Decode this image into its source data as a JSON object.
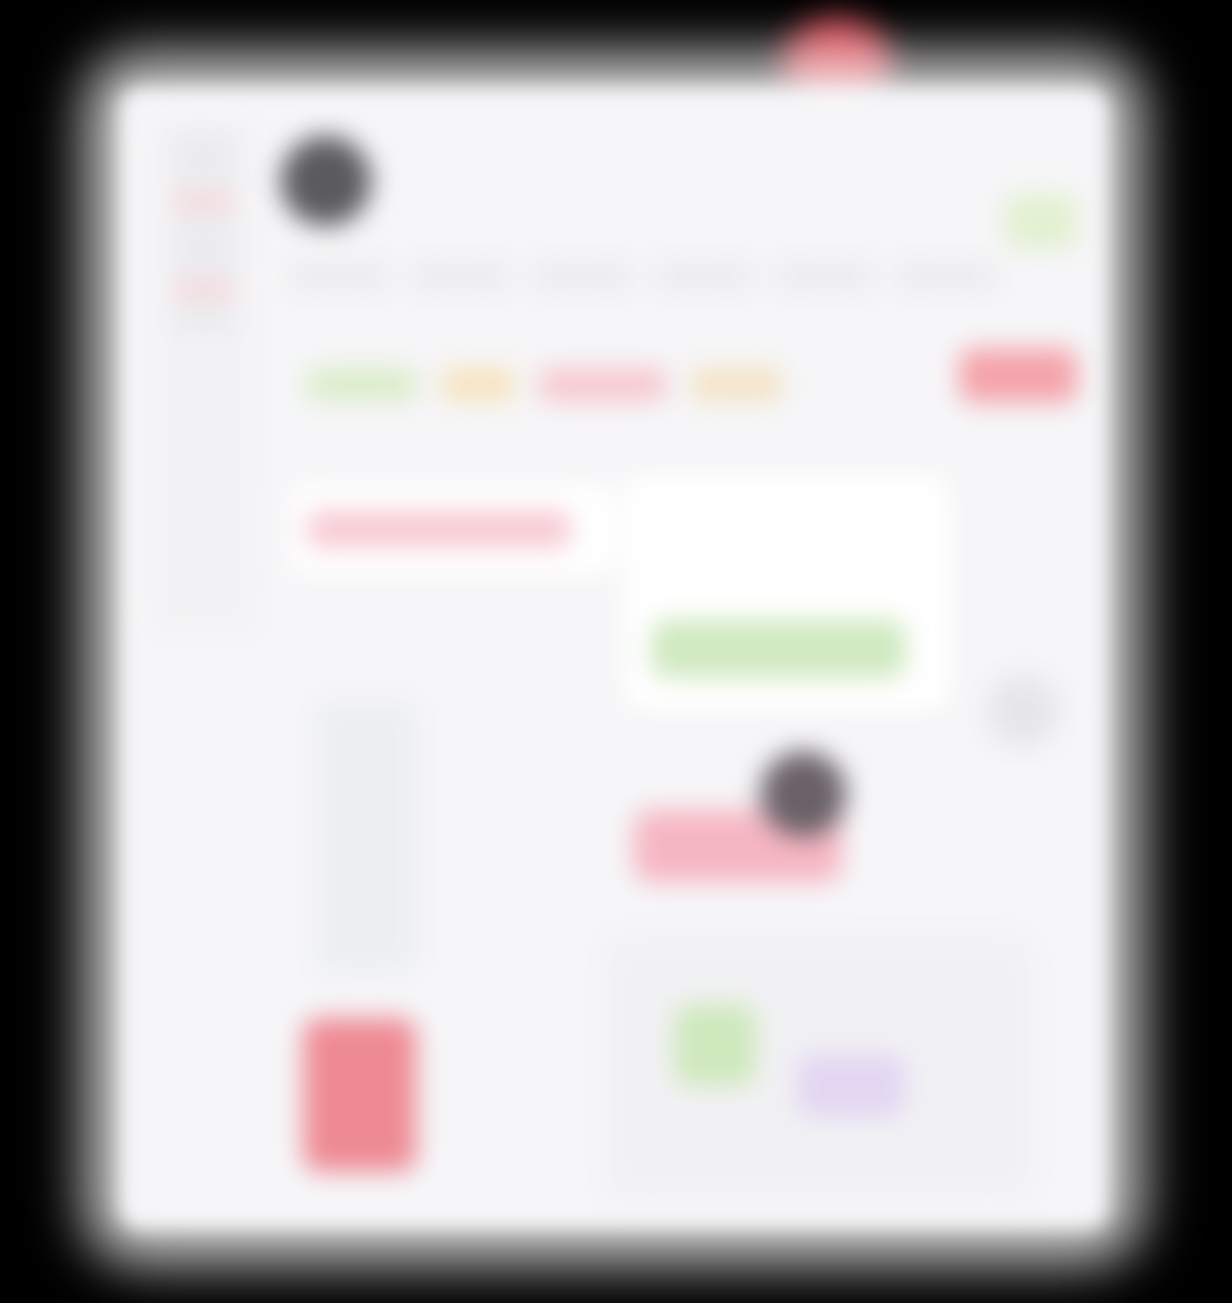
{
  "window": {
    "title": ""
  },
  "colors": {
    "background": "#000000",
    "surface": "#f6f6f8",
    "accent_red": "#e84a57",
    "accent_green": "#cfe9c0",
    "accent_pink": "#f7c9d2",
    "accent_purple": "#e3d6f2"
  },
  "icons": {
    "camera": "camera-notch-icon",
    "avatar": "avatar-icon"
  }
}
